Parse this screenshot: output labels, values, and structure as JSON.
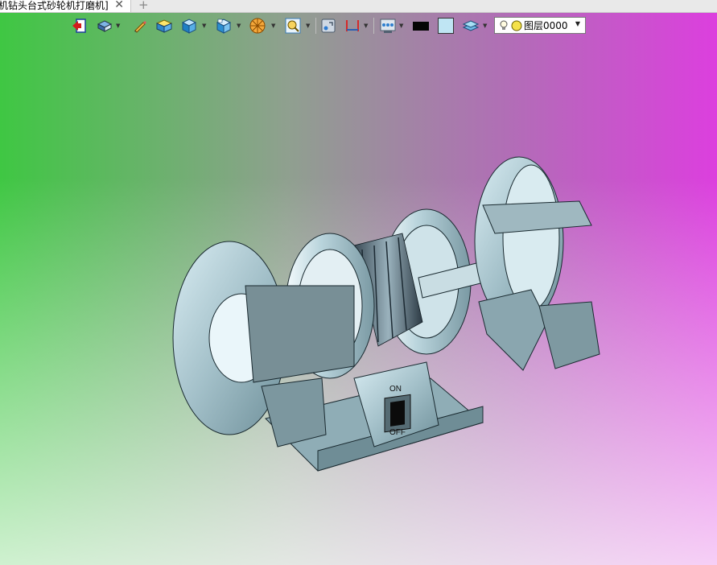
{
  "window": {
    "tab_title": "机钻头台式砂轮机打磨机]",
    "close_glyph": "✕",
    "add_glyph": "+"
  },
  "toolbar": {
    "buttons": [
      {
        "name": "exit-icon"
      },
      {
        "name": "view-orient-icon"
      },
      {
        "name": "pencil-sketch-icon"
      },
      {
        "name": "shaded-solid-icon"
      },
      {
        "name": "shaded-edges-icon"
      },
      {
        "name": "view-cube-icon"
      },
      {
        "name": "section-view-icon"
      },
      {
        "name": "zoom-fit-icon"
      },
      {
        "name": "render-icon"
      },
      {
        "name": "dimension-icon"
      },
      {
        "name": "display-filter-icon"
      },
      {
        "name": "color-black-swatch"
      },
      {
        "name": "color-lightblue-swatch"
      },
      {
        "name": "layers-icon"
      }
    ],
    "layer": {
      "label": "图层0000"
    }
  },
  "model": {
    "switch_on": "ON",
    "switch_off": "OFF"
  },
  "colors": {
    "bg_left": "#3fc743",
    "bg_right": "#dc3fde",
    "part_fill": "#a7c3cc",
    "part_dark": "#6f8a93"
  }
}
